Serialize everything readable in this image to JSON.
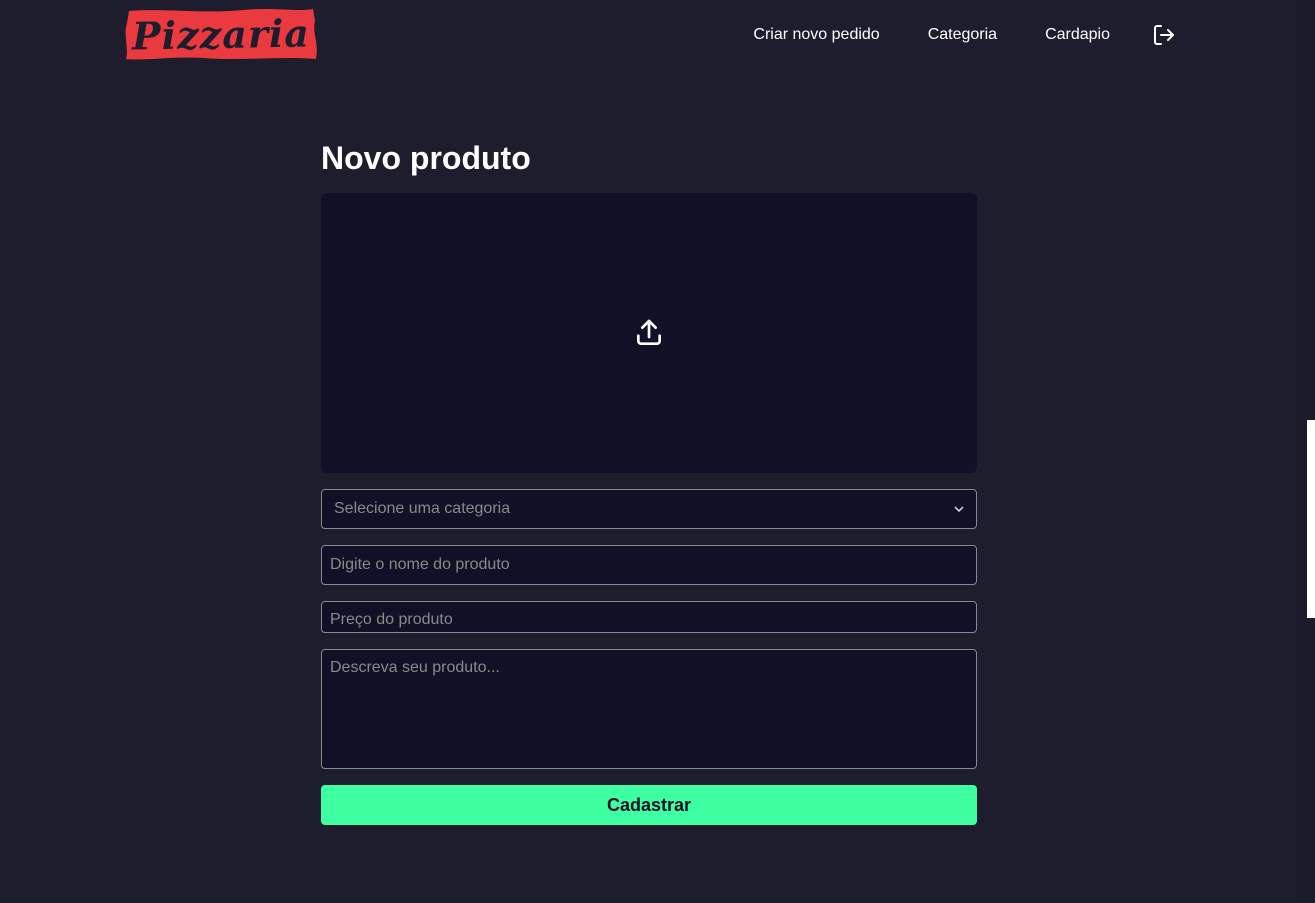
{
  "header": {
    "logo_text": "Pizzaria",
    "nav": [
      {
        "label": "Criar novo pedido"
      },
      {
        "label": "Categoria"
      },
      {
        "label": "Cardapio"
      }
    ],
    "logout_icon": "logout-icon"
  },
  "main": {
    "title": "Novo produto",
    "upload_icon": "upload-icon",
    "category_select": {
      "placeholder": "Selecione uma categoria"
    },
    "name_input": {
      "placeholder": "Digite o nome do produto",
      "value": ""
    },
    "price_input": {
      "placeholder": "Preço do produto",
      "value": ""
    },
    "description": {
      "placeholder": "Descreva seu produto...",
      "value": ""
    },
    "submit_label": "Cadastrar"
  },
  "colors": {
    "background": "#1d1d2e",
    "panel": "#101026",
    "accent": "#3fffa3",
    "brand": "#ea3a3f"
  }
}
